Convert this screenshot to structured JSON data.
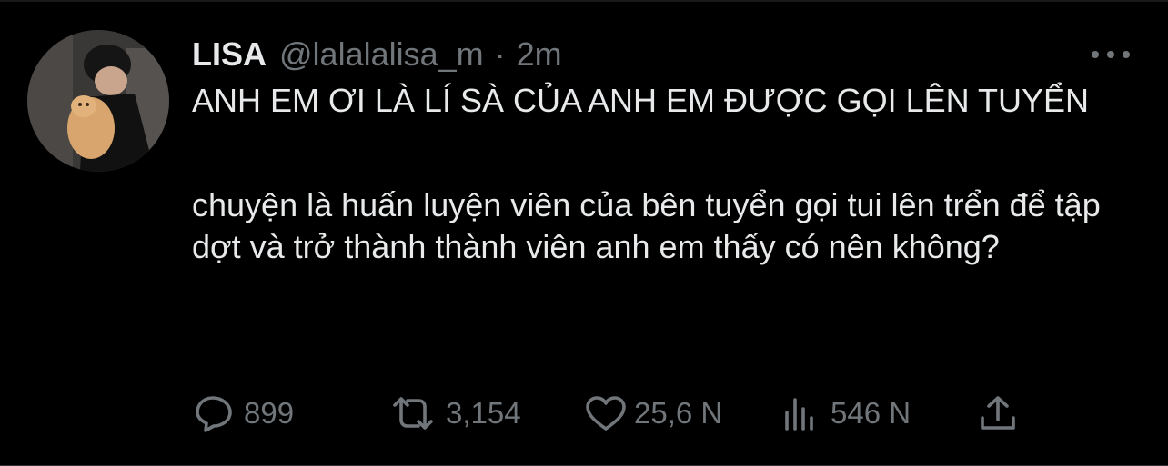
{
  "tweet": {
    "author_name": "LISA",
    "author_handle": "@lalalalisa_m",
    "separator": "·",
    "time": "2m",
    "text_line1": "ANH EM ƠI LÀ LÍ SÀ CỦA ANH EM ĐƯỢC GỌI LÊN TUYỂN",
    "text_para2": "chuyện là huấn luyện viên của bên tuyển gọi tui lên trển để tập dợt và trở thành thành viên anh em thấy có nên không?"
  },
  "actions": {
    "reply_count": "899",
    "retweet_count": "3,154",
    "like_count": "25,6 N",
    "views_count": "546 N"
  },
  "icons": {
    "more": "more-horizontal-icon",
    "reply": "reply-bubble-icon",
    "retweet": "retweet-arrows-icon",
    "like": "heart-icon",
    "views": "bar-chart-icon",
    "share": "share-upload-icon"
  },
  "colors": {
    "background": "#000000",
    "text_primary": "#e7e9ea",
    "text_secondary": "#71767b"
  }
}
